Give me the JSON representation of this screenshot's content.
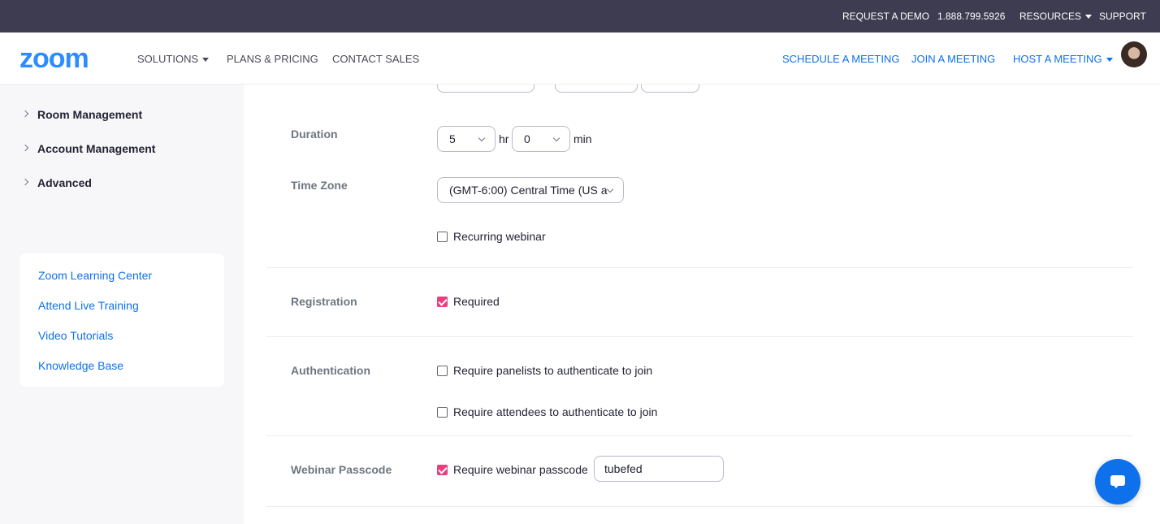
{
  "topbar": {
    "request_demo": "REQUEST A DEMO",
    "phone": "1.888.799.5926",
    "resources": "RESOURCES",
    "support": "SUPPORT"
  },
  "nav": {
    "logo": "zoom",
    "solutions": "SOLUTIONS",
    "plans": "PLANS & PRICING",
    "contact": "CONTACT SALES",
    "schedule": "SCHEDULE A MEETING",
    "join": "JOIN A MEETING",
    "host": "HOST A MEETING"
  },
  "sidebar": {
    "items": [
      {
        "label": "Room Management"
      },
      {
        "label": "Account Management"
      },
      {
        "label": "Advanced"
      }
    ],
    "learning": [
      {
        "label": "Zoom Learning Center"
      },
      {
        "label": "Attend Live Training"
      },
      {
        "label": "Video Tutorials"
      },
      {
        "label": "Knowledge Base"
      }
    ]
  },
  "form": {
    "duration": {
      "label": "Duration",
      "hours": "5",
      "hours_unit": "hr",
      "minutes": "0",
      "minutes_unit": "min"
    },
    "timezone": {
      "label": "Time Zone",
      "value": "(GMT-6:00) Central Time (US a"
    },
    "recurring": {
      "label": "Recurring webinar",
      "checked": false
    },
    "registration": {
      "label": "Registration",
      "option": "Required",
      "checked": true
    },
    "authentication": {
      "label": "Authentication",
      "panelists": "Require panelists to authenticate to join",
      "attendees": "Require attendees to authenticate to join"
    },
    "passcode": {
      "label": "Webinar Passcode",
      "option": "Require webinar passcode",
      "checked": true,
      "value": "tubefed"
    }
  },
  "colors": {
    "topbar": "#3d3c51",
    "brand": "#2d8cff",
    "link": "#0e71eb",
    "checkbox_on": "#e8407f"
  }
}
